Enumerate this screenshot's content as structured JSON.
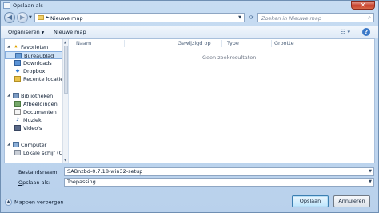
{
  "window": {
    "title": "Opslaan als",
    "close_label": "✕"
  },
  "navigation": {
    "back_glyph": "◀",
    "forward_glyph": "▶",
    "path_separator": "►",
    "current_folder": "Nieuwe map",
    "search_placeholder": "Zoeken in Nieuwe map"
  },
  "toolbar": {
    "organize_label": "Organiseren",
    "new_folder_label": "Nieuwe map"
  },
  "sidebar": {
    "favorites": {
      "label": "Favorieten",
      "items": [
        {
          "label": "Bureaublad",
          "icon": "desktop-icon",
          "selected": true
        },
        {
          "label": "Downloads",
          "icon": "downloads-icon"
        },
        {
          "label": "Dropbox",
          "icon": "dropbox-icon"
        },
        {
          "label": "Recente locaties",
          "icon": "recent-places-icon"
        }
      ]
    },
    "libraries": {
      "label": "Bibliotheken",
      "items": [
        {
          "label": "Afbeeldingen",
          "icon": "pictures-icon"
        },
        {
          "label": "Documenten",
          "icon": "documents-icon"
        },
        {
          "label": "Muziek",
          "icon": "music-icon"
        },
        {
          "label": "Video's",
          "icon": "videos-icon"
        }
      ]
    },
    "computer": {
      "label": "Computer",
      "items": [
        {
          "label": "Lokale schijf (C:)",
          "icon": "local-disk-icon"
        }
      ]
    }
  },
  "file_list": {
    "columns": [
      "Naam",
      "Gewijzigd op",
      "Type",
      "Grootte"
    ],
    "empty_message": "Geen zoekresultaten."
  },
  "save_form": {
    "filename_label_prefix": "Bestands",
    "filename_label_underlined": "n",
    "filename_label_suffix": "aam:",
    "filename_value": "SABnzbd-0.7.18-win32-setup",
    "savetype_label_prefix": "",
    "savetype_label_underlined": "O",
    "savetype_label_suffix": "pslaan als:",
    "savetype_value": "Toepassing"
  },
  "footer": {
    "hide_folders_label": "Mappen verbergen",
    "save_button": "Opslaan",
    "cancel_button": "Annuleren"
  }
}
